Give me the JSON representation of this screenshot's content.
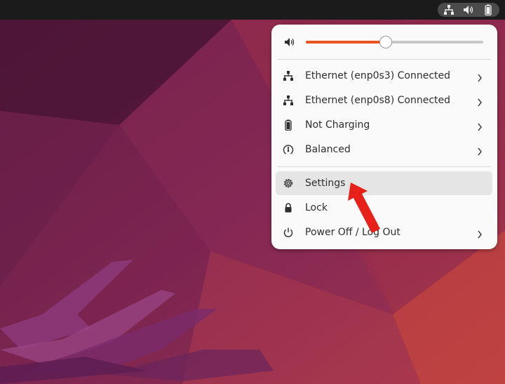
{
  "topbar": {
    "indicators": [
      {
        "icon": "network-wired-icon"
      },
      {
        "icon": "speaker-icon"
      },
      {
        "icon": "battery-icon"
      }
    ]
  },
  "menu": {
    "volume": {
      "icon": "speaker-icon",
      "level_percent": 45
    },
    "items": [
      {
        "label": "Ethernet (enp0s3) Connected",
        "icon": "network-wired-icon",
        "has_submenu": true
      },
      {
        "label": "Ethernet (enp0s8) Connected",
        "icon": "network-wired-icon",
        "has_submenu": true
      },
      {
        "label": "Not Charging",
        "icon": "battery-icon",
        "has_submenu": true
      },
      {
        "label": "Balanced",
        "icon": "power-profile-icon",
        "has_submenu": true
      },
      {
        "label": "Settings",
        "icon": "gear-icon",
        "has_submenu": false,
        "highlighted": true
      },
      {
        "label": "Lock",
        "icon": "lock-icon",
        "has_submenu": false
      },
      {
        "label": "Power Off / Log Out",
        "icon": "power-icon",
        "has_submenu": true
      }
    ]
  },
  "annotation": {
    "icon": "red-arrow-icon",
    "color": "#e8201a"
  },
  "colors": {
    "accent": "#e95420",
    "menu_bg": "#fafafa",
    "topbar": "#1b1b1b"
  }
}
